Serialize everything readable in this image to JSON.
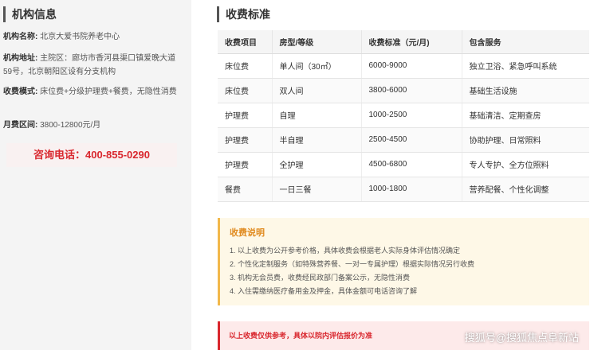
{
  "sidebar": {
    "title": "机构信息",
    "name_label": "机构名称:",
    "name_value": "北京大爱书院养老中心",
    "address_label": "机构地址:",
    "address_value": "主院区：廊坊市香河县渠口镇爱晚大道59号，北京朝阳区设有分支机构",
    "mode_label": "收费模式:",
    "mode_value": "床位费+分级护理费+餐费，无隐性消费",
    "range_label": "月费区间:",
    "range_value": "3800-12800元/月",
    "phone_label": "咨询电话：",
    "phone_value": "400-855-0290"
  },
  "main": {
    "title": "收费标准",
    "table": {
      "headers": [
        "收费项目",
        "房型/等级",
        "收费标准（元/月)",
        "包含服务"
      ],
      "rows": [
        [
          "床位费",
          "单人间（30㎡）",
          "6000-9000",
          "独立卫浴、紧急呼叫系统"
        ],
        [
          "床位费",
          "双人间",
          "3800-6000",
          "基础生活设施"
        ],
        [
          "护理费",
          "自理",
          "1000-2500",
          "基础清洁、定期查房"
        ],
        [
          "护理费",
          "半自理",
          "2500-4500",
          "协助护理、日常照料"
        ],
        [
          "护理费",
          "全护理",
          "4500-6800",
          "专人专护、全方位照料"
        ],
        [
          "餐费",
          "一日三餐",
          "1000-1800",
          "营养配餐、个性化调整"
        ]
      ]
    },
    "note": {
      "title": "收费说明",
      "items": [
        "1. 以上收费为公开参考价格，具体收费会根据老人实际身体评估情况确定",
        "2. 个性化定制服务（如特殊营养餐、一对一专属护理）根据实际情况另行收费",
        "3. 机构无会员费，收费经民政部门备案公示，无隐性消费",
        "4. 入住需缴纳医疗备用金及押金，具体金额可电话咨询了解"
      ]
    },
    "warning": "以上收费仅供参考，具体以院内评估报价为准",
    "watermark": "搜狐号@搜狐焦点阜新站"
  }
}
